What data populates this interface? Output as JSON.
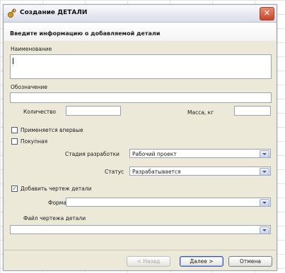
{
  "window": {
    "title": "Создание ДЕТАЛИ",
    "close_glyph": "✕"
  },
  "header": {
    "instruction": "Введите информацию о добавляемой детали"
  },
  "form": {
    "name_label": "Наименование",
    "name_value": "",
    "designation_label": "Обозначение",
    "designation_value": "",
    "quantity_label": "Количество",
    "quantity_value": "",
    "mass_label": "Масса, кг",
    "mass_value": "",
    "applied_first_label": "Применяется впервые",
    "applied_first_checked": false,
    "purchased_label": "Покупная",
    "purchased_checked": false,
    "stage_label": "Стадия разработки",
    "stage_value": "Рабочий проект",
    "status_label": "Статус",
    "status_value": "Разрабатывается",
    "add_drawing_label": "Добавить чертеж детали",
    "add_drawing_checked": true,
    "check_glyph": "✓",
    "format_label": "Формат",
    "format_value": "",
    "drawing_file_label": "Файл чертежа детали",
    "drawing_file_value": ""
  },
  "buttons": {
    "back_label": "< Назад",
    "next_label": "Далее >",
    "cancel_label": "Отмена"
  },
  "icons": {
    "app": "wrench-gear-icon",
    "close": "close-icon",
    "dropdown": "chevron-down-icon"
  },
  "colors": {
    "dialog_bg": "#ece9d8",
    "close_red": "#c64628",
    "check_green": "#1e8f2a"
  }
}
